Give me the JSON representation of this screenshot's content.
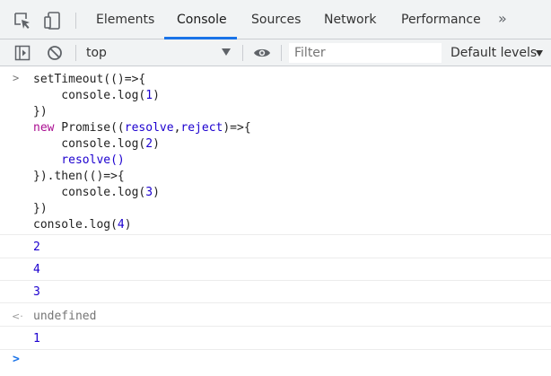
{
  "tabs": {
    "elements": "Elements",
    "console": "Console",
    "sources": "Sources",
    "network": "Network",
    "performance": "Performance",
    "more": "»"
  },
  "toolbar": {
    "context": "top",
    "filter_placeholder": "Filter",
    "levels": "Default levels"
  },
  "code": {
    "l1": "setTimeout(()=>{",
    "l2": "    console.log(",
    "l2n": "1",
    "l2e": ")",
    "l3": "})",
    "l4kw": "new",
    "l4a": " Promise((",
    "l4p1": "resolve",
    "l4c": ",",
    "l4p2": "reject",
    "l4b": ")=>{",
    "l5": "    console.log(",
    "l5n": "2",
    "l5e": ")",
    "l6": "    resolve()",
    "l7": "}).then(()=>{",
    "l8": "    console.log(",
    "l8n": "3",
    "l8e": ")",
    "l9": "})",
    "l10": "console.log(",
    "l10n": "4",
    "l10e": ")"
  },
  "outputs": [
    "2",
    "4",
    "3"
  ],
  "return_value": "undefined",
  "late_output": "1",
  "colors": {
    "accent": "#1a73e8",
    "number": "#1c00cf",
    "keyword": "#aa0d91"
  }
}
